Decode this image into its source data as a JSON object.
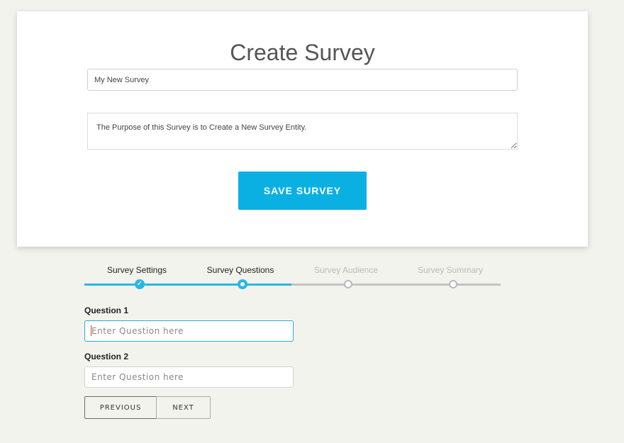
{
  "form": {
    "title": "Create Survey",
    "name_value": "My New Survey",
    "purpose_value": "The Purpose of this Survey is to Create a New Survey Entity.",
    "save_label": "SAVE SURVEY"
  },
  "stepper": {
    "steps": [
      {
        "label": "Survey Settings",
        "state": "complete"
      },
      {
        "label": "Survey Questions",
        "state": "current"
      },
      {
        "label": "Survey Audience",
        "state": "upcoming"
      },
      {
        "label": "Survey Summary",
        "state": "upcoming"
      }
    ],
    "check_glyph": "✓"
  },
  "questions": [
    {
      "label": "Question 1",
      "placeholder": "Enter Question here",
      "value": ""
    },
    {
      "label": "Question 2",
      "placeholder": "Enter Question here",
      "value": ""
    }
  ],
  "nav": {
    "previous_label": "PREVIOUS",
    "next_label": "NEXT"
  },
  "colors": {
    "accent": "#0bb0e3",
    "progress": "#29b6e6",
    "inactive": "#c3c3c3",
    "background": "#f3f3ee"
  },
  "icons": {
    "complete_step": "check-icon",
    "current_step": "current-step-dot-icon",
    "upcoming_step": "empty-step-circle-icon"
  }
}
